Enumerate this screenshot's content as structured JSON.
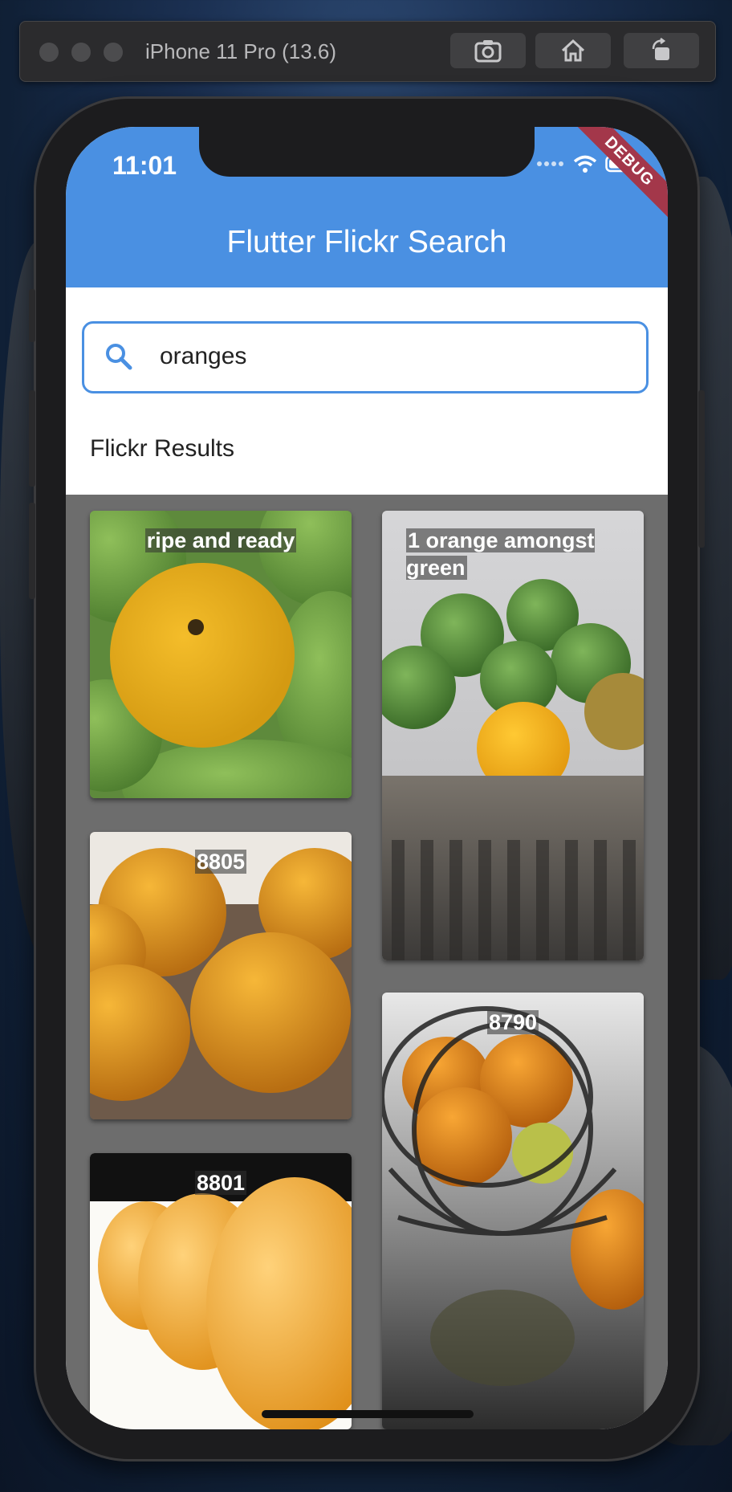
{
  "simulator": {
    "title": "iPhone 11 Pro (13.6)",
    "buttons": [
      "screenshot-icon",
      "home-icon",
      "rotate-icon"
    ]
  },
  "status_bar": {
    "time": "11:01"
  },
  "debug_banner": "DEBUG",
  "app_bar": {
    "title": "Flutter Flickr Search"
  },
  "search": {
    "value": "oranges",
    "icon": "search-icon"
  },
  "results": {
    "heading": "Flickr Results",
    "photos": [
      {
        "caption": "ripe and ready"
      },
      {
        "caption": "1 orange amongst green"
      },
      {
        "caption": "8805"
      },
      {
        "caption": "8790"
      },
      {
        "caption": "8801"
      }
    ]
  },
  "colors": {
    "primary": "#4a90e2",
    "grid_background": "#6d6d6d",
    "debug_banner": "#a3374a"
  }
}
